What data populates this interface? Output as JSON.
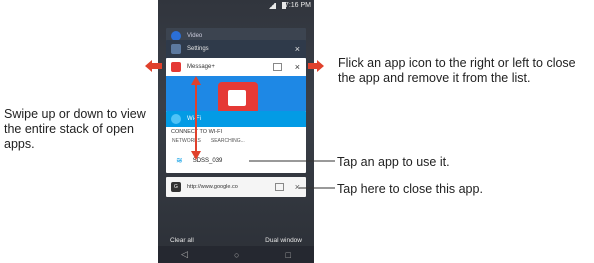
{
  "status_bar": {
    "time": "7:16 PM"
  },
  "recent_cards": {
    "back1_label": "Video",
    "settings_title": "Settings",
    "message_title": "Message+",
    "wifi_title": "Wi-Fi",
    "wifi_heading": "CONNECT TO WI-FI",
    "wifi_tabs": [
      "NETWORKS",
      "SEARCHING..."
    ],
    "wifi_network": "SDSS_039",
    "google_url": "http://www.google.co"
  },
  "bottom_bar": {
    "clear_all": "Clear all",
    "dual_window": "Dual window"
  },
  "callouts": {
    "flick": "Flick an app icon to the right or left to close the app and remove it from the list.",
    "swipe": "Swipe up or down to view the entire stack of open apps.",
    "tap_app": "Tap an app to use it.",
    "tap_close": "Tap here to close this app."
  },
  "colors": {
    "arrow_red": "#e0412c",
    "settings_bar": "#2f3a4a",
    "message_red": "#e53935",
    "message_bg": "#1e88e5",
    "wifi_blue": "#039be5",
    "home_bg": "#34383f"
  },
  "icons": {
    "settings": "gear-icon",
    "message": "message-bubble-icon",
    "wifi": "wifi-icon",
    "google": "letter-g-icon",
    "close": "close-icon",
    "split": "split-window-icon",
    "nav": [
      "back-icon",
      "home-icon",
      "recents-icon"
    ]
  }
}
